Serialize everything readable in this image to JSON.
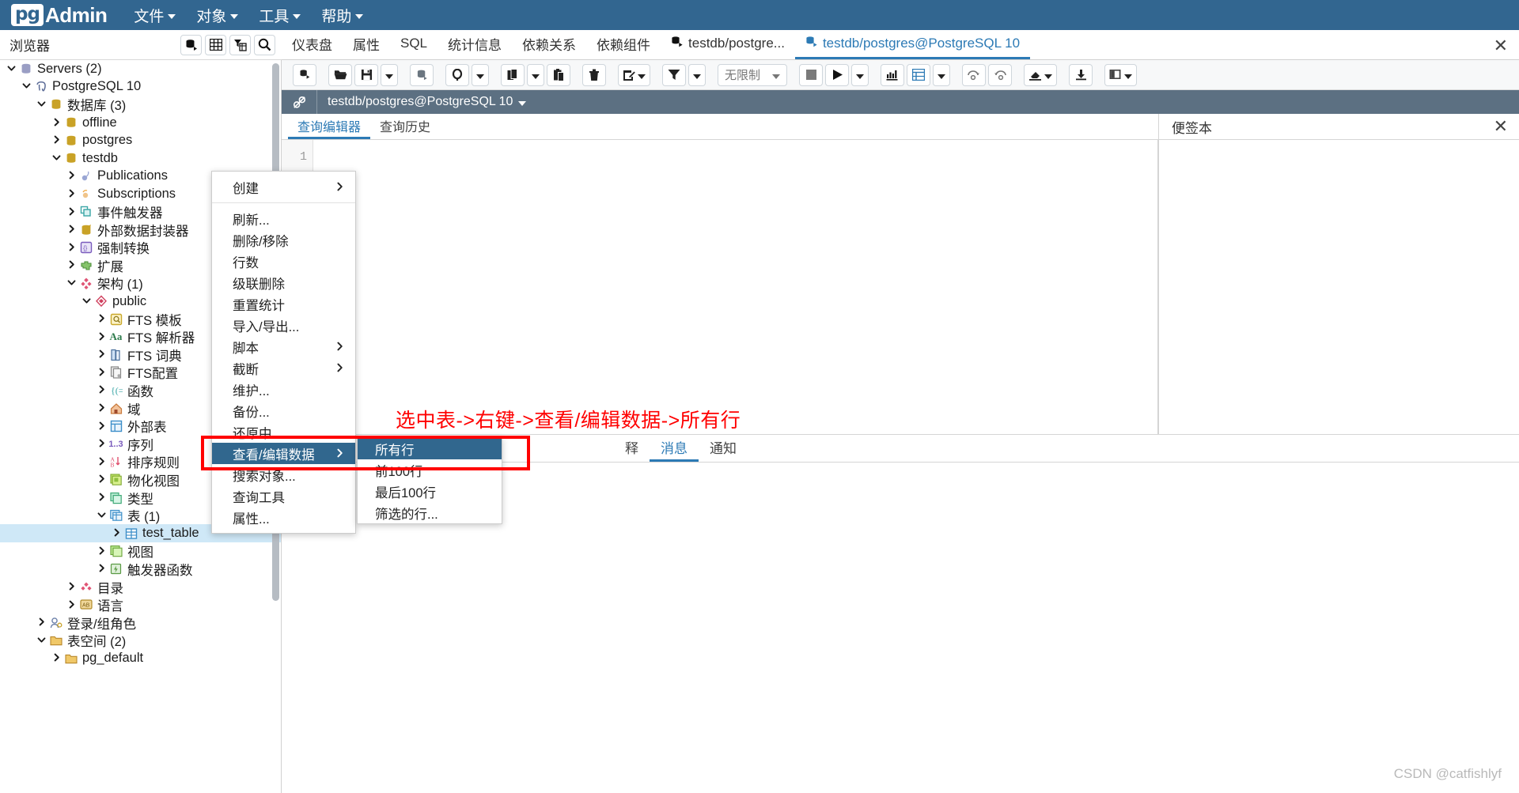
{
  "app": {
    "brand_pg": "pg",
    "brand_admin": "Admin",
    "menus": [
      {
        "label": "文件",
        "name": "menu-file"
      },
      {
        "label": "对象",
        "name": "menu-object"
      },
      {
        "label": "工具",
        "name": "menu-tools"
      },
      {
        "label": "帮助",
        "name": "menu-help"
      }
    ]
  },
  "browser": {
    "title": "浏览器",
    "icons": [
      "server-icon",
      "grid-icon",
      "filter-icon",
      "search-icon"
    ]
  },
  "tabs": [
    {
      "label": "仪表盘",
      "active": false
    },
    {
      "label": "属性",
      "active": false
    },
    {
      "label": "SQL",
      "active": false
    },
    {
      "label": "统计信息",
      "active": false
    },
    {
      "label": "依赖关系",
      "active": false
    },
    {
      "label": "依赖组件",
      "active": false
    },
    {
      "label": "testdb/postgre...",
      "active": false,
      "icon": "query-tool-icon"
    },
    {
      "label": "testdb/postgres@PostgreSQL 10",
      "active": true,
      "icon": "query-tool-icon"
    }
  ],
  "tree": [
    {
      "label": "Servers (2)",
      "depth": 0,
      "arrow": "down",
      "icon": "servers-icon",
      "selected": false
    },
    {
      "label": "PostgreSQL 10",
      "depth": 1,
      "arrow": "down",
      "icon": "postgres-icon",
      "selected": false
    },
    {
      "label": "数据库 (3)",
      "depth": 2,
      "arrow": "down",
      "icon": "database-group-icon",
      "selected": false
    },
    {
      "label": "offline",
      "depth": 3,
      "arrow": "right",
      "icon": "database-icon",
      "selected": false
    },
    {
      "label": "postgres",
      "depth": 3,
      "arrow": "right",
      "icon": "database-icon",
      "selected": false
    },
    {
      "label": "testdb",
      "depth": 3,
      "arrow": "down",
      "icon": "database-icon",
      "selected": false
    },
    {
      "label": "Publications",
      "depth": 4,
      "arrow": "right",
      "icon": "publication-icon",
      "selected": false
    },
    {
      "label": "Subscriptions",
      "depth": 4,
      "arrow": "right",
      "icon": "subscription-icon",
      "selected": false
    },
    {
      "label": "事件触发器",
      "depth": 4,
      "arrow": "right",
      "icon": "event-trigger-icon",
      "selected": false
    },
    {
      "label": "外部数据封装器",
      "depth": 4,
      "arrow": "right",
      "icon": "fdw-icon",
      "selected": false
    },
    {
      "label": "强制转换",
      "depth": 4,
      "arrow": "right",
      "icon": "cast-icon",
      "selected": false
    },
    {
      "label": "扩展",
      "depth": 4,
      "arrow": "right",
      "icon": "extension-icon",
      "selected": false
    },
    {
      "label": "架构 (1)",
      "depth": 4,
      "arrow": "down",
      "icon": "schema-group-icon",
      "selected": false
    },
    {
      "label": "public",
      "depth": 5,
      "arrow": "down",
      "icon": "schema-icon",
      "selected": false
    },
    {
      "label": "FTS 模板",
      "depth": 6,
      "arrow": "right",
      "icon": "fts-template-icon",
      "selected": false
    },
    {
      "label": "FTS 解析器",
      "depth": 6,
      "arrow": "right",
      "icon": "fts-parser-icon",
      "selected": false
    },
    {
      "label": "FTS 词典",
      "depth": 6,
      "arrow": "right",
      "icon": "fts-dictionary-icon",
      "selected": false
    },
    {
      "label": "FTS配置",
      "depth": 6,
      "arrow": "right",
      "icon": "fts-configuration-icon",
      "selected": false
    },
    {
      "label": "函数",
      "depth": 6,
      "arrow": "right",
      "icon": "function-icon",
      "selected": false
    },
    {
      "label": "域",
      "depth": 6,
      "arrow": "right",
      "icon": "domain-icon",
      "selected": false
    },
    {
      "label": "外部表",
      "depth": 6,
      "arrow": "right",
      "icon": "foreign-table-icon",
      "selected": false
    },
    {
      "label": "序列",
      "depth": 6,
      "arrow": "right",
      "icon": "sequence-icon",
      "selected": false
    },
    {
      "label": "排序规则",
      "depth": 6,
      "arrow": "right",
      "icon": "collation-icon",
      "selected": false
    },
    {
      "label": "物化视图",
      "depth": 6,
      "arrow": "right",
      "icon": "materialized-view-icon",
      "selected": false
    },
    {
      "label": "类型",
      "depth": 6,
      "arrow": "right",
      "icon": "type-icon",
      "selected": false
    },
    {
      "label": "表 (1)",
      "depth": 6,
      "arrow": "down",
      "icon": "table-group-icon",
      "selected": false
    },
    {
      "label": "test_table",
      "depth": 7,
      "arrow": "right",
      "icon": "table-icon",
      "selected": true
    },
    {
      "label": "视图",
      "depth": 6,
      "arrow": "right",
      "icon": "view-icon",
      "selected": false
    },
    {
      "label": "触发器函数",
      "depth": 6,
      "arrow": "right",
      "icon": "trigger-function-icon",
      "selected": false
    },
    {
      "label": "目录",
      "depth": 4,
      "arrow": "right",
      "icon": "catalog-icon",
      "selected": false
    },
    {
      "label": "语言",
      "depth": 4,
      "arrow": "right",
      "icon": "language-icon",
      "selected": false
    },
    {
      "label": "登录/组角色",
      "depth": 2,
      "arrow": "right",
      "icon": "login-role-icon",
      "selected": false
    },
    {
      "label": "表空间 (2)",
      "depth": 2,
      "arrow": "down",
      "icon": "tablespace-icon",
      "selected": false
    },
    {
      "label": "pg_default",
      "depth": 3,
      "arrow": "right",
      "icon": "tablespace-icon",
      "selected": false
    }
  ],
  "query_tool": {
    "toolbar": [
      {
        "name": "open-query-tool-button",
        "icon": "query-tool-icon"
      },
      {
        "name": "open-file-button",
        "icon": "folder-open-icon"
      },
      {
        "name": "save-file-button",
        "icon": "save-icon"
      },
      {
        "name": "save-file-dropdown",
        "icon": "chevron-down-icon"
      },
      {
        "name": "connection-button",
        "icon": "database-connect-icon"
      },
      {
        "name": "find-button",
        "icon": "search-icon"
      },
      {
        "name": "find-dropdown",
        "icon": "chevron-down-icon"
      },
      {
        "name": "copy-button",
        "icon": "copy-icon"
      },
      {
        "name": "copy-dropdown",
        "icon": "chevron-down-icon"
      },
      {
        "name": "paste-button",
        "icon": "paste-icon"
      },
      {
        "name": "delete-button",
        "icon": "trash-icon"
      },
      {
        "name": "edit-button",
        "icon": "edit-icon"
      },
      {
        "name": "edit-dropdown",
        "icon": "chevron-down-icon"
      },
      {
        "name": "filter-button",
        "icon": "filter-icon"
      },
      {
        "name": "filter-dropdown",
        "icon": "chevron-down-icon"
      },
      {
        "name": "row-limit-select",
        "icon": "chevron-down-icon"
      },
      {
        "name": "stop-button",
        "icon": "stop-icon"
      },
      {
        "name": "execute-button",
        "icon": "play-icon"
      },
      {
        "name": "execute-dropdown",
        "icon": "chevron-down-icon"
      },
      {
        "name": "explain-button",
        "icon": "explain-icon"
      },
      {
        "name": "explain-analyze-button",
        "icon": "explain-analyze-icon"
      },
      {
        "name": "explain-options-dropdown",
        "icon": "chevron-down-icon"
      },
      {
        "name": "commit-button",
        "icon": "commit-icon"
      },
      {
        "name": "rollback-button",
        "icon": "rollback-icon"
      },
      {
        "name": "clear-button",
        "icon": "eraser-icon"
      },
      {
        "name": "clear-dropdown",
        "icon": "chevron-down-icon"
      },
      {
        "name": "download-button",
        "icon": "download-icon"
      },
      {
        "name": "macros-button",
        "icon": "macros-icon"
      },
      {
        "name": "macros-dropdown",
        "icon": "chevron-down-icon"
      }
    ],
    "row_limit_label": "无限制",
    "connection_label": "testdb/postgres@PostgreSQL 10",
    "editor_tabs": [
      {
        "label": "查询编辑器",
        "active": true
      },
      {
        "label": "查询历史",
        "active": false
      }
    ],
    "line_number": "1",
    "scratch_pad_title": "便签本",
    "result_tabs": [
      {
        "label": "释",
        "active": false
      },
      {
        "label": "消息",
        "active": true
      },
      {
        "label": "通知",
        "active": false
      }
    ]
  },
  "context_menu": {
    "items": [
      {
        "label": "创建",
        "submenu": true,
        "highlighted": false
      },
      {
        "separator": true
      },
      {
        "label": "刷新...",
        "submenu": false,
        "highlighted": false
      },
      {
        "label": "删除/移除",
        "submenu": false,
        "highlighted": false
      },
      {
        "label": "行数",
        "submenu": false,
        "highlighted": false
      },
      {
        "label": "级联删除",
        "submenu": false,
        "highlighted": false
      },
      {
        "label": "重置统计",
        "submenu": false,
        "highlighted": false
      },
      {
        "label": "导入/导出...",
        "submenu": false,
        "highlighted": false
      },
      {
        "label": "脚本",
        "submenu": true,
        "highlighted": false
      },
      {
        "label": "截断",
        "submenu": true,
        "highlighted": false
      },
      {
        "label": "维护...",
        "submenu": false,
        "highlighted": false
      },
      {
        "label": "备份...",
        "submenu": false,
        "highlighted": false
      },
      {
        "label": "还原中",
        "submenu": false,
        "highlighted": false
      },
      {
        "label": "查看/编辑数据",
        "submenu": true,
        "highlighted": true
      },
      {
        "label": "搜索对象...",
        "submenu": false,
        "highlighted": false
      },
      {
        "label": "查询工具",
        "submenu": false,
        "highlighted": false
      },
      {
        "label": "属性...",
        "submenu": false,
        "highlighted": false
      }
    ],
    "submenu": [
      {
        "label": "所有行",
        "highlighted": true
      },
      {
        "label": "前100行",
        "highlighted": false
      },
      {
        "label": "最后100行",
        "highlighted": false
      },
      {
        "label": "筛选的行...",
        "highlighted": false
      }
    ]
  },
  "annotation": {
    "text": "选中表->右键->查看/编辑数据->所有行",
    "color": "#ff0000"
  },
  "watermark": "CSDN @catfishlyf",
  "colors": {
    "brand": "#326690",
    "accent": "#2c7ab5",
    "menu_highlight": "#31678e",
    "selection": "#cfe8f7",
    "annotation_red": "#ff0000"
  }
}
